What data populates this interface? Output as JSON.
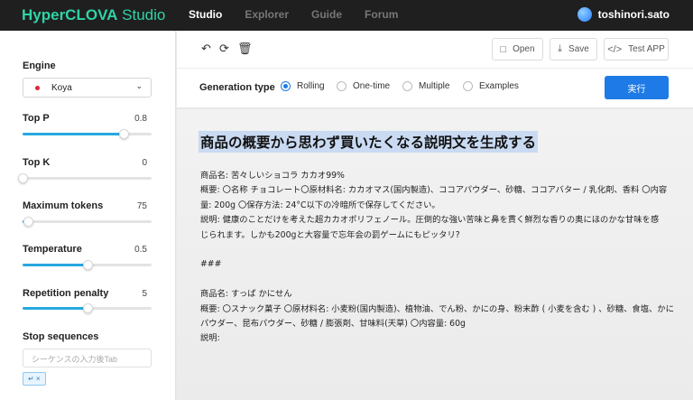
{
  "header": {
    "logo_main": "HyperCLOVA",
    "logo_sub": " Studio",
    "nav": [
      "Studio",
      "Explorer",
      "Guide",
      "Forum"
    ],
    "active_nav": "Studio",
    "username": "toshinori.sato"
  },
  "sidebar": {
    "engine_label": "Engine",
    "engine_value": "Koya",
    "params": [
      {
        "label": "Top P",
        "value": "0.8",
        "fraction": 0.78
      },
      {
        "label": "Top K",
        "value": "0",
        "fraction": 0.0
      },
      {
        "label": "Maximum tokens",
        "value": "75",
        "fraction": 0.04
      },
      {
        "label": "Temperature",
        "value": "0.5",
        "fraction": 0.5
      },
      {
        "label": "Repetition penalty",
        "value": "5",
        "fraction": 0.5
      }
    ],
    "stop_label": "Stop sequences",
    "stop_placeholder": "シーケンスの入力後Tab",
    "stop_chip": "↵ ×"
  },
  "toolbar": {
    "open_label": "Open",
    "save_label": "Save",
    "test_label": "Test APP"
  },
  "generation": {
    "label": "Generation type",
    "options": [
      "Rolling",
      "One-time",
      "Multiple",
      "Examples"
    ],
    "selected": "Rolling",
    "run_label": "実行"
  },
  "editor": {
    "heading": "商品の概要から思わず買いたくなる説明文を生成する",
    "lines1": [
      "商品名: 苦々しいショコラ カカオ99%",
      "概要: 〇名称 チョコレート〇原材料名: カカオマス(国内製造)、ココアパウダー、砂糖、ココアバター / 乳化剤、香料 〇内容",
      "量: 200g 〇保存方法: 24°C以下の冷暗所で保存してください。",
      "説明: 健康のことだけを考えた超カカオポリフェノール。圧倒的な強い苦味と鼻を貫く鮮烈な香りの奥にほのかな甘味を感",
      "じられます。しかも200gと大容量で忘年会の罰ゲームにもピッタリ?"
    ],
    "separator": "###",
    "lines2": [
      "商品名: すっぱ かにせん",
      "概要: 〇スナック菓子 〇原材料名: 小麦粉(国内製造)、植物油、でん粉、かにの身、粉末酢 ( 小麦を含む ) 、砂糖、食塩、かに",
      "パウダー、昆布パウダー、砂糖 / 膨張剤、甘味料(天草) 〇内容量: 60g",
      "説明:"
    ]
  }
}
